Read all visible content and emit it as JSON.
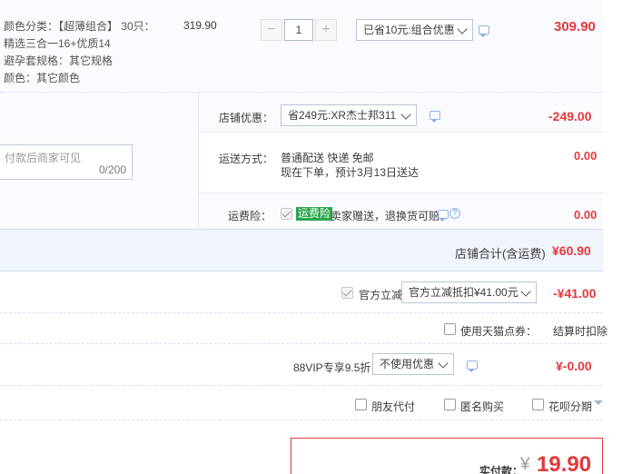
{
  "item": {
    "attrs": [
      "颜色分类：【超薄组合】 30只：",
      "精选三合一16+优质14",
      "避孕套规格：其它规格",
      "颜色：其它颜色"
    ],
    "unit_price": "319.90",
    "quantity": "1",
    "qty_minus": "−",
    "qty_plus": "+",
    "promo_select": "已省10元:组合优惠",
    "subtotal": "309.90"
  },
  "shop": {
    "coupon_label": "店铺优惠：",
    "coupon_select": "省249元:XR杰士邦311",
    "coupon_amount": "-249.00",
    "message_placeholder": "付款后商家可见",
    "message_count": "0/200",
    "shipping_label": "运送方式：",
    "shipping_line1": "普通配送 快递 免邮",
    "shipping_line2": "现在下单，预计3月13日送达",
    "shipping_amount": "0.00",
    "insurance_label": "运费险：",
    "insurance_badge": "运费险",
    "insurance_text": "卖家赠送，退换货可赔",
    "insurance_amount": "0.00",
    "total_label": "店铺合计(含运费)",
    "total_amount": "¥60.90"
  },
  "official": {
    "label": "官方立减",
    "select": "官方立减抵扣¥41.00元",
    "amount": "-¥41.00"
  },
  "tmall_points": {
    "label": "使用天猫点券：",
    "note": "结算时扣除"
  },
  "vip": {
    "label": "88VIP专享9.5折",
    "select": "不使用优惠",
    "amount": "¥-0.00"
  },
  "options": {
    "friend_pay": "朋友代付",
    "anonymous": "匿名购买",
    "huabei": "花呗分期"
  },
  "payment": {
    "label": "实付款：",
    "currency": "¥",
    "amount": "19.90"
  }
}
